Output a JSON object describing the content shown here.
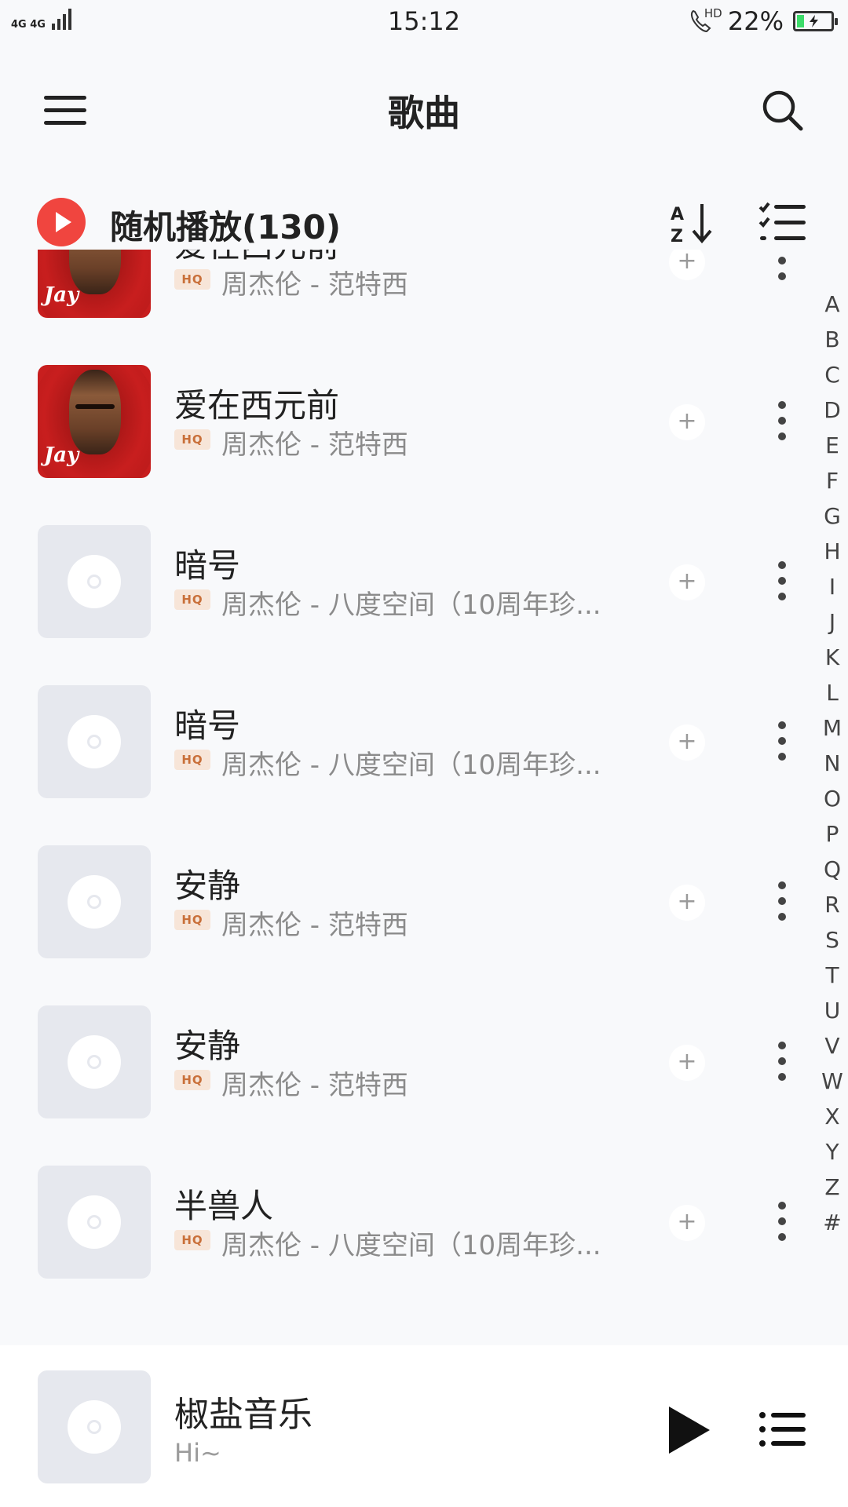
{
  "status_bar": {
    "network": "4G 4G",
    "time": "15:12",
    "call_icon": "hd-call-icon",
    "hd_label": "HD",
    "battery_text": "22%",
    "battery_level": 0.22,
    "battery_color": "#3ddc6a"
  },
  "header": {
    "title": "歌曲",
    "menu_icon": "hamburger-menu-icon",
    "search_icon": "search-icon"
  },
  "shuffle": {
    "label": "随机播放(130)",
    "icon": "play-circle-icon",
    "accent": "#f0453f",
    "sort_icon": "sort-az-icon",
    "sort_label_a": "A",
    "sort_label_z": "Z",
    "multi_select_icon": "checklist-icon"
  },
  "songs": [
    {
      "title": "爱在西元前",
      "quality": "HQ",
      "subtitle": "周杰伦 - 范特西",
      "cover": "album-art",
      "art_text": "Jay"
    },
    {
      "title": "爱在西元前",
      "quality": "HQ",
      "subtitle": "周杰伦 - 范特西",
      "cover": "album-art",
      "art_text": "Jay"
    },
    {
      "title": "暗号",
      "quality": "HQ",
      "subtitle": "周杰伦 - 八度空间（10周年珍...",
      "cover": "placeholder-disc"
    },
    {
      "title": "暗号",
      "quality": "HQ",
      "subtitle": "周杰伦 - 八度空间（10周年珍...",
      "cover": "placeholder-disc"
    },
    {
      "title": "安静",
      "quality": "HQ",
      "subtitle": "周杰伦 - 范特西",
      "cover": "placeholder-disc"
    },
    {
      "title": "安静",
      "quality": "HQ",
      "subtitle": "周杰伦 - 范特西",
      "cover": "placeholder-disc"
    },
    {
      "title": "半兽人",
      "quality": "HQ",
      "subtitle": "周杰伦 - 八度空间（10周年珍...",
      "cover": "placeholder-disc"
    }
  ],
  "row_actions": {
    "add": "+",
    "more_icon": "more-vertical-icon"
  },
  "alphabet": [
    "A",
    "B",
    "C",
    "D",
    "E",
    "F",
    "G",
    "H",
    "I",
    "J",
    "K",
    "L",
    "M",
    "N",
    "O",
    "P",
    "Q",
    "R",
    "S",
    "T",
    "U",
    "V",
    "W",
    "X",
    "Y",
    "Z",
    "#"
  ],
  "mini_player": {
    "title": "椒盐音乐",
    "subtitle": "Hi~",
    "play_icon": "play-icon",
    "queue_icon": "playlist-icon"
  }
}
